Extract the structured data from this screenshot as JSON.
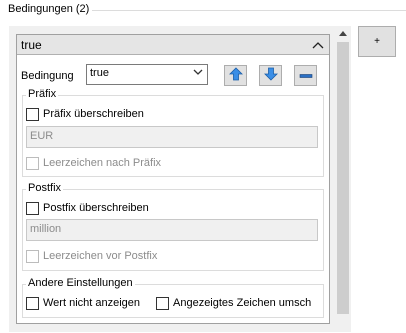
{
  "conditions_group": {
    "title": "Bedingungen (2)"
  },
  "panel": {
    "title": "true",
    "collapse_glyph": "^"
  },
  "condition": {
    "label": "Bedingung",
    "selected": "true",
    "dropdown_glyph": "v"
  },
  "toolbar": {
    "up_icon": "arrow-up-icon",
    "down_icon": "arrow-down-icon",
    "remove_icon": "minus-icon",
    "accent": "#2a7fd4"
  },
  "prefix": {
    "title": "Präfix",
    "override_label": "Präfix überschreiben",
    "value": "EUR",
    "space_label": "Leerzeichen nach Präfix"
  },
  "postfix": {
    "title": "Postfix",
    "override_label": "Postfix überschreiben",
    "value": "million",
    "space_label": "Leerzeichen vor Postfix"
  },
  "other": {
    "title": "Andere Einstellungen",
    "hide_value_label": "Wert nicht anzeigen",
    "displayed_char_label": "Angezeigtes Zeichen umsch"
  },
  "add_button": {
    "label": "+"
  }
}
